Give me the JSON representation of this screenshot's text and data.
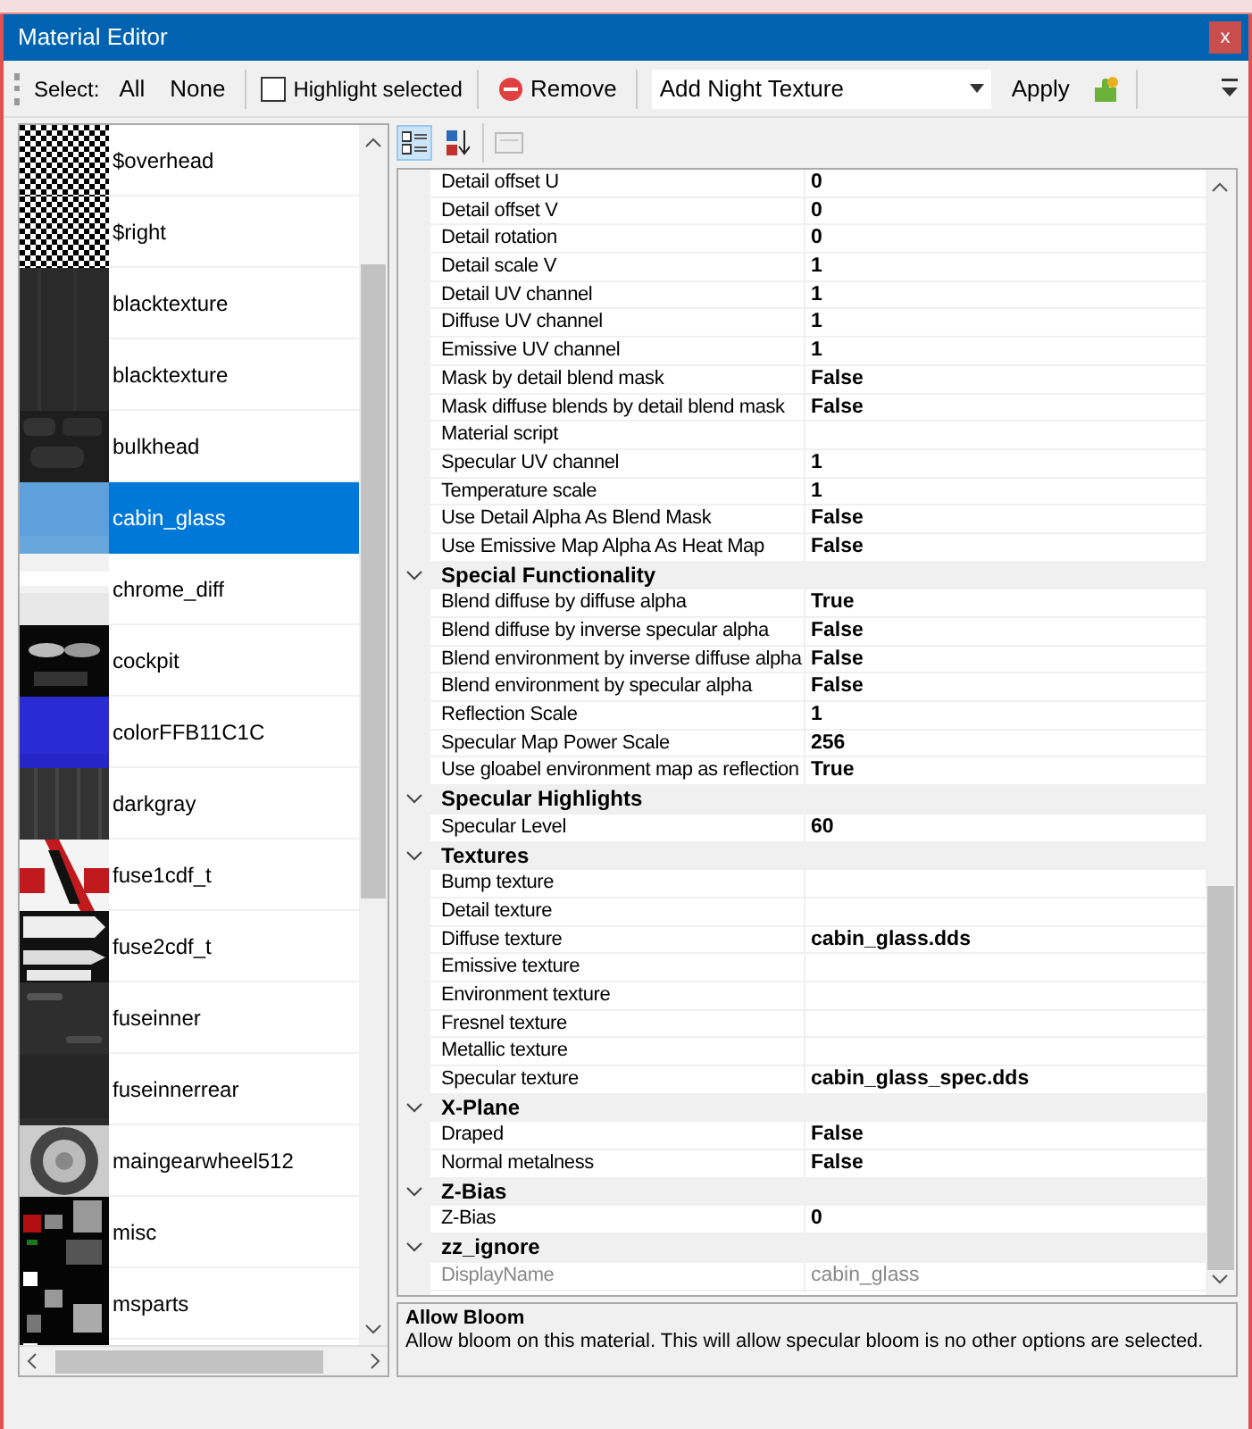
{
  "window": {
    "title": "Material Editor",
    "close": "x"
  },
  "toolbar": {
    "select_label": "Select:",
    "all": "All",
    "none": "None",
    "highlight": {
      "label": "Highlight selected",
      "checked": false
    },
    "remove": "Remove",
    "night_texture": "Add Night Texture",
    "apply": "Apply"
  },
  "materials": [
    {
      "name": "$overhead",
      "selected": false
    },
    {
      "name": "$right",
      "selected": false
    },
    {
      "name": "blacktexture",
      "selected": false
    },
    {
      "name": "blacktexture",
      "selected": false
    },
    {
      "name": "bulkhead",
      "selected": false
    },
    {
      "name": "cabin_glass",
      "selected": true
    },
    {
      "name": "chrome_diff",
      "selected": false
    },
    {
      "name": "cockpit",
      "selected": false
    },
    {
      "name": "colorFFB11C1C",
      "selected": false
    },
    {
      "name": "darkgray",
      "selected": false
    },
    {
      "name": "fuse1cdf_t",
      "selected": false
    },
    {
      "name": "fuse2cdf_t",
      "selected": false
    },
    {
      "name": "fuseinner",
      "selected": false
    },
    {
      "name": "fuseinnerrear",
      "selected": false
    },
    {
      "name": "maingearwheel512",
      "selected": false
    },
    {
      "name": "misc",
      "selected": false
    },
    {
      "name": "msparts",
      "selected": false
    },
    {
      "selected": false
    }
  ],
  "property_toolbar": {
    "categorized_selected": true,
    "alphabetical_selected": false,
    "pages_disabled": true
  },
  "sections": [
    {
      "rows": [
        {
          "name": "Detail offset U",
          "value": "0"
        },
        {
          "name": "Detail offset V",
          "value": "0"
        },
        {
          "name": "Detail rotation",
          "value": "0"
        },
        {
          "name": "Detail scale V",
          "value": "1"
        },
        {
          "name": "Detail UV channel",
          "value": "1"
        },
        {
          "name": "Diffuse UV channel",
          "value": "1"
        },
        {
          "name": "Emissive UV channel",
          "value": "1"
        },
        {
          "name": "Mask by detail blend mask",
          "value": "False"
        },
        {
          "name": "Mask diffuse blends by detail blend mask",
          "value": "False"
        },
        {
          "name": "Material script"
        },
        {
          "name": "Specular UV channel",
          "value": "1"
        },
        {
          "name": "Temperature scale",
          "value": "1"
        },
        {
          "name": "Use Detail Alpha As Blend Mask",
          "value": "False"
        },
        {
          "name": "Use Emissive Map Alpha As Heat Map",
          "value": "False"
        }
      ]
    },
    {
      "title": "Special Functionality",
      "expanded": true,
      "rows": [
        {
          "name": "Blend diffuse by diffuse alpha",
          "value": "True"
        },
        {
          "name": "Blend diffuse by inverse specular alpha",
          "value": "False"
        },
        {
          "name": "Blend environment by inverse diffuse alpha",
          "value": "False"
        },
        {
          "name": "Blend environment by specular alpha",
          "value": "False"
        },
        {
          "name": "Reflection Scale",
          "value": "1"
        },
        {
          "name": "Specular Map Power Scale",
          "value": "256"
        },
        {
          "name": "Use gloabel environment map as reflection",
          "value": "True"
        }
      ]
    },
    {
      "title": "Specular Highlights",
      "expanded": true,
      "rows": [
        {
          "name": "Specular Level",
          "value": "60"
        }
      ]
    },
    {
      "title": "Textures",
      "expanded": true,
      "rows": [
        {
          "name": "Bump texture"
        },
        {
          "name": "Detail texture"
        },
        {
          "name": "Diffuse texture",
          "value": "cabin_glass.dds"
        },
        {
          "name": "Emissive texture"
        },
        {
          "name": "Environment texture"
        },
        {
          "name": "Fresnel texture"
        },
        {
          "name": "Metallic texture"
        },
        {
          "name": "Specular texture",
          "value": "cabin_glass_spec.dds"
        }
      ]
    },
    {
      "title": "X-Plane",
      "expanded": true,
      "rows": [
        {
          "name": "Draped",
          "value": "False"
        },
        {
          "name": "Normal metalness",
          "value": "False"
        }
      ]
    },
    {
      "title": "Z-Bias",
      "expanded": true,
      "rows": [
        {
          "name": "Z-Bias",
          "value": "0"
        }
      ]
    },
    {
      "title": "zz_ignore",
      "expanded": true,
      "rows": [
        {
          "name": "DisplayName",
          "value": "cabin_glass",
          "disabled": true
        }
      ]
    }
  ],
  "description": {
    "title": "Allow Bloom",
    "text": "Allow bloom on this material. This will allow specular bloom is no other options are selected."
  }
}
